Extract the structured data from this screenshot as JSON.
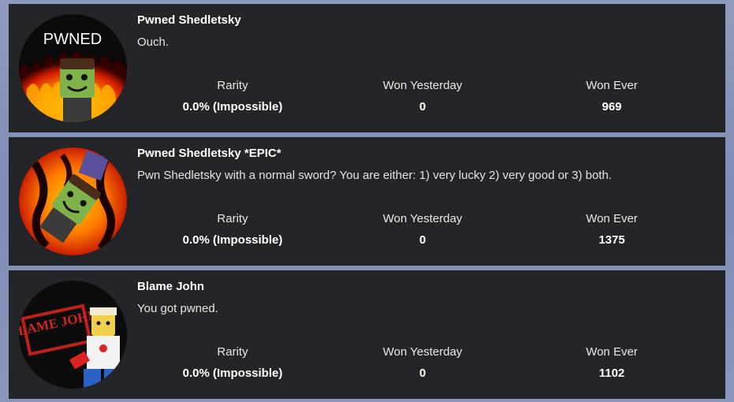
{
  "badges": [
    {
      "title": "Pwned Shedletsky",
      "description": "Ouch.",
      "image_text": "PWNED",
      "image_icon": "pwned-badge-icon",
      "rarity_label": "Rarity",
      "rarity_value": "0.0% (Impossible)",
      "yesterday_label": "Won Yesterday",
      "yesterday_value": "0",
      "ever_label": "Won Ever",
      "ever_value": "969"
    },
    {
      "title": "Pwned Shedletsky *EPIC*",
      "description": "Pwn Shedletsky with a normal sword? You are either: 1) very lucky 2) very good or 3) both.",
      "image_icon": "pwned-epic-badge-icon",
      "rarity_label": "Rarity",
      "rarity_value": "0.0% (Impossible)",
      "yesterday_label": "Won Yesterday",
      "yesterday_value": "0",
      "ever_label": "Won Ever",
      "ever_value": "1375"
    },
    {
      "title": "Blame John",
      "description": "You got pwned.",
      "image_text": "BLAME JOHN.",
      "image_icon": "blame-john-badge-icon",
      "rarity_label": "Rarity",
      "rarity_value": "0.0% (Impossible)",
      "yesterday_label": "Won Yesterday",
      "yesterday_value": "0",
      "ever_label": "Won Ever",
      "ever_value": "1102"
    }
  ],
  "colors": {
    "page_background": "#8a97bc",
    "card_background": "#232529",
    "text": "#ffffff"
  }
}
